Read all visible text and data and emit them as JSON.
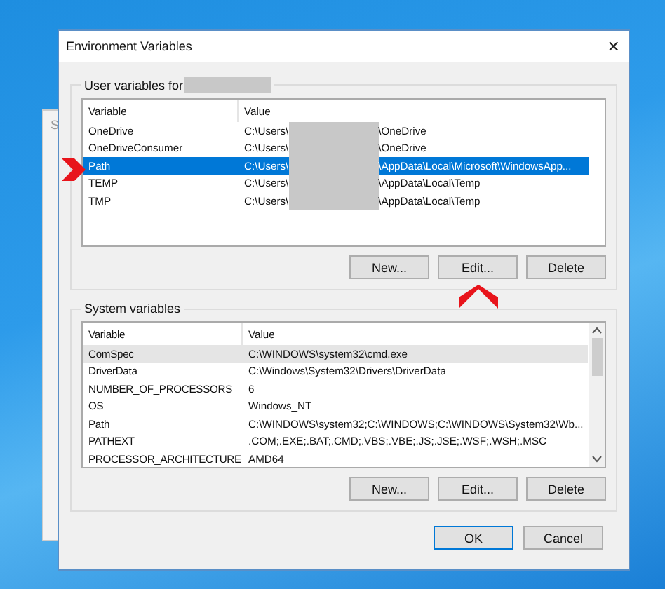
{
  "background_window": {
    "title": "S"
  },
  "window": {
    "title": "Environment Variables",
    "close": "✕"
  },
  "user_variables": {
    "label": "User variables for",
    "name_redacted": true,
    "columns": [
      "Variable",
      "Value"
    ],
    "rows": [
      {
        "variable": "OneDrive",
        "value_start": "C:\\Users\\",
        "value_end": "\\OneDrive",
        "redacted": true,
        "selected": false
      },
      {
        "variable": "OneDriveConsumer",
        "value_start": "C:\\Users\\",
        "value_end": "\\OneDrive",
        "redacted": true,
        "selected": false
      },
      {
        "variable": "Path",
        "value_start": "C:\\Users\\",
        "value_end": "\\AppData\\Local\\Microsoft\\WindowsApp...",
        "redacted": true,
        "selected": true
      },
      {
        "variable": "TEMP",
        "value_start": "C:\\Users\\",
        "value_end": "\\AppData\\Local\\Temp",
        "redacted": true,
        "selected": false
      },
      {
        "variable": "TMP",
        "value_start": "C:\\Users\\",
        "value_end": "\\AppData\\Local\\Temp",
        "redacted": true,
        "selected": false
      }
    ],
    "buttons": [
      "New...",
      "Edit...",
      "Delete"
    ]
  },
  "system_variables": {
    "label": "System variables",
    "columns": [
      "Variable",
      "Value"
    ],
    "rows": [
      {
        "variable": "ComSpec",
        "value": "C:\\WINDOWS\\system32\\cmd.exe",
        "selected": true
      },
      {
        "variable": "DriverData",
        "value": "C:\\Windows\\System32\\Drivers\\DriverData",
        "selected": false
      },
      {
        "variable": "NUMBER_OF_PROCESSORS",
        "value": "6",
        "selected": false
      },
      {
        "variable": "OS",
        "value": "Windows_NT",
        "selected": false
      },
      {
        "variable": "Path",
        "value": "C:\\WINDOWS\\system32;C:\\WINDOWS;C:\\WINDOWS\\System32\\Wb...",
        "selected": false
      },
      {
        "variable": "PATHEXT",
        "value": ".COM;.EXE;.BAT;.CMD;.VBS;.VBE;.JS;.JSE;.WSF;.WSH;.MSC",
        "selected": false
      },
      {
        "variable": "PROCESSOR_ARCHITECTURE",
        "value": "AMD64",
        "selected": false
      }
    ],
    "buttons": [
      "New...",
      "Edit...",
      "Delete"
    ]
  },
  "dialog_buttons": [
    {
      "label": "OK",
      "default": true
    },
    {
      "label": "Cancel",
      "default": false
    }
  ],
  "annotations": [
    {
      "kind": "arrow-right"
    },
    {
      "kind": "arrow-up"
    }
  ]
}
